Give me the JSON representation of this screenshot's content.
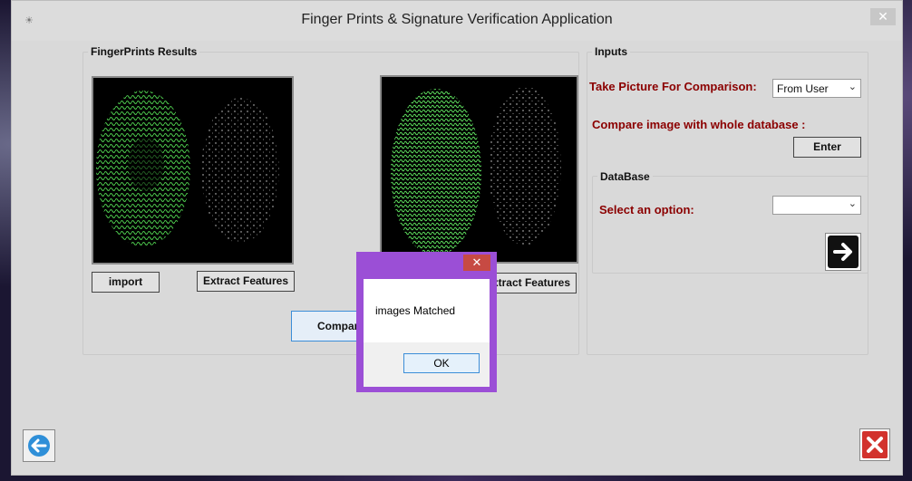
{
  "window": {
    "title": "Finger Prints & Signature Verification Application",
    "title_icon": "fingerprint-icon",
    "close_label": "✕"
  },
  "fingerprints": {
    "group_label": "FingerPrints Results",
    "import_label": "import",
    "extract_left_label": "Extract Features",
    "extract_right_label": "Extract Features",
    "compare_label": "Compare"
  },
  "inputs": {
    "group_label": "Inputs",
    "take_picture_label": "Take Picture For Comparison:",
    "take_picture_value": "From User",
    "compare_db_label": "Compare image with whole database :",
    "enter_label": "Enter"
  },
  "database": {
    "group_label": "DataBase",
    "select_label": "Select an option:",
    "select_value": ""
  },
  "dialog": {
    "close_label": "✕",
    "message": "images Matched",
    "ok_label": "OK"
  },
  "icons": {
    "back": "back-arrow-icon",
    "next": "next-arrow-icon",
    "exit": "exit-x-icon"
  },
  "colors": {
    "label_red": "#8b0000",
    "dialog_border": "#9b4fd6",
    "dialog_close": "#c74a43",
    "exit_red": "#d2322d",
    "back_blue": "#2f8fd8"
  }
}
